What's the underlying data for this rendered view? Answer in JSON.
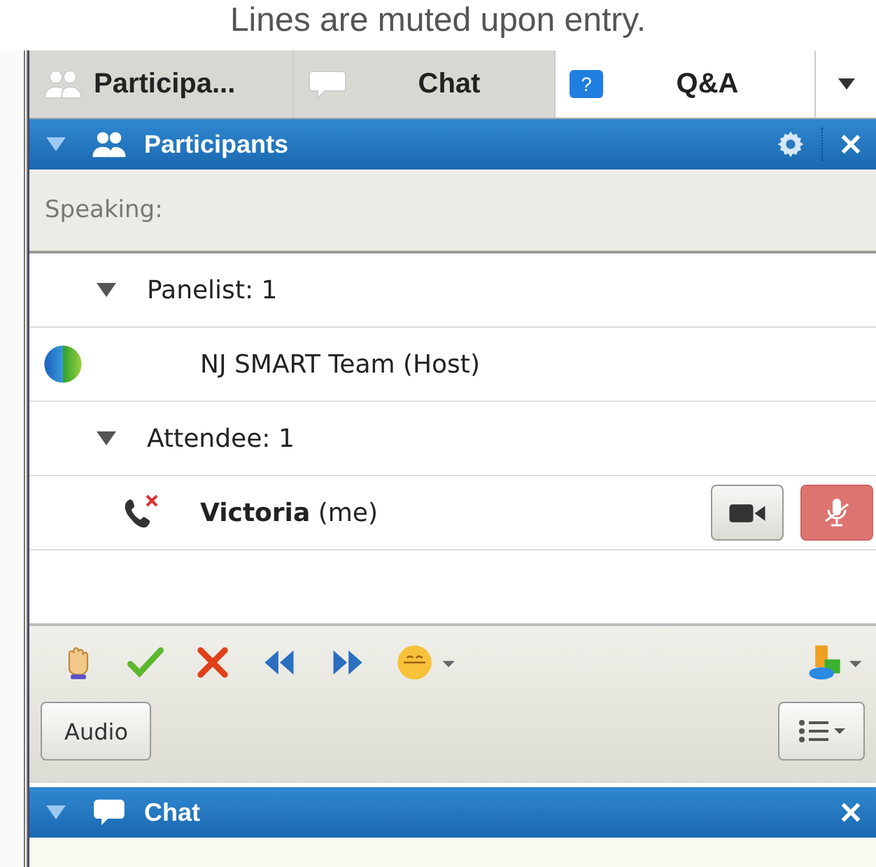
{
  "caption": "Lines are muted upon entry.",
  "tabs": [
    {
      "label": "Participa...",
      "kind": "people",
      "open": true
    },
    {
      "label": "Chat",
      "kind": "chat",
      "open": true
    },
    {
      "label": "Q&A",
      "kind": "help",
      "icon_text": "?",
      "open": false
    }
  ],
  "participants_panel": {
    "title": "Participants",
    "expanded": true,
    "speaking_label": "Speaking:",
    "groups": [
      {
        "label": "Panelist: 1",
        "expanded": true,
        "members": [
          {
            "name": "NJ SMART Team (Host)",
            "kind": "web"
          }
        ]
      },
      {
        "label": "Attendee: 1",
        "expanded": true,
        "members": [
          {
            "name": "**Victoria** (me)",
            "kind": "phone_off",
            "mic_muted": true
          }
        ]
      }
    ]
  },
  "audio_button": "Audio",
  "chat_panel": {
    "title": "Chat",
    "expanded": true
  }
}
